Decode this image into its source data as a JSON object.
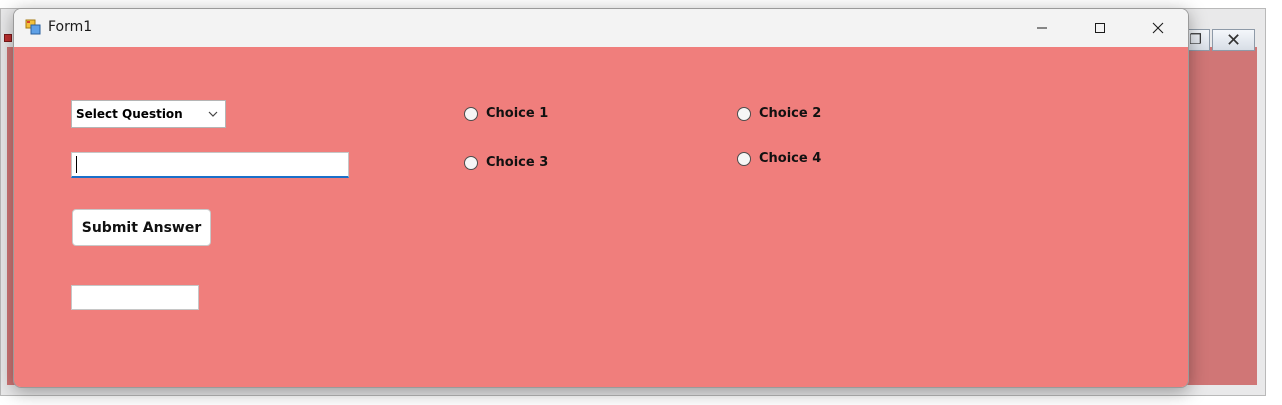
{
  "window": {
    "title": "Form1",
    "client_color": "#f07e7c"
  },
  "background_window": {
    "restore_glyph": "❐",
    "close_glyph": "✕"
  },
  "form": {
    "question_select": {
      "selected": "Select Question"
    },
    "answer_input": {
      "value": ""
    },
    "submit_button": {
      "label": "Submit Answer"
    },
    "result_box": {
      "value": ""
    },
    "choices": [
      {
        "label": "Choice 1",
        "checked": false
      },
      {
        "label": "Choice 2",
        "checked": false
      },
      {
        "label": "Choice 3",
        "checked": false
      },
      {
        "label": "Choice 4",
        "checked": false
      }
    ]
  },
  "icons": {
    "app": "form-app-icon",
    "minimize": "minimize-icon",
    "maximize": "maximize-icon",
    "close": "close-icon",
    "dropdown": "chevron-down-icon"
  }
}
